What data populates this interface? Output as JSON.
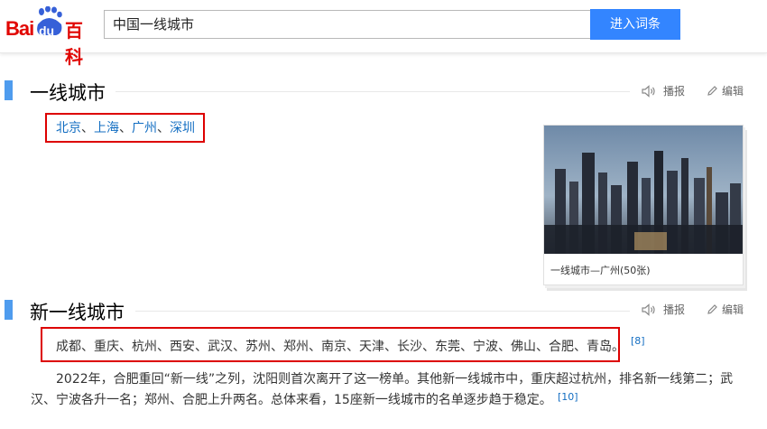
{
  "header": {
    "logo": {
      "bai": "Bai",
      "du": "du",
      "baike": "百科"
    },
    "search_value": "中国一线城市",
    "search_button": "进入词条"
  },
  "sections": [
    {
      "title": "一线城市",
      "tools": {
        "broadcast": "播报",
        "edit": "编辑"
      },
      "cities": [
        "北京",
        "上海",
        "广州",
        "深圳"
      ]
    },
    {
      "title": "新一线城市",
      "tools": {
        "broadcast": "播报",
        "edit": "编辑"
      },
      "cities": [
        "成都",
        "重庆",
        "杭州",
        "西安",
        "武汉",
        "苏州",
        "郑州",
        "南京",
        "天津",
        "长沙",
        "东莞",
        "宁波",
        "佛山",
        "合肥",
        "青岛"
      ],
      "cities_ref": "[8]",
      "paragraph_line1": "2022年，合肥重回“新一线”之列，沈阳则首次离开了这一榜单。其他新一线城市中，重庆超过杭州，排名新一线第二；武",
      "paragraph_line2": "汉、宁波各升一名；郑州、合肥上升两名。总体来看，15座新一线城市的名单逐步趋于稳定。",
      "paragraph_ref": "[10]"
    }
  ],
  "photo": {
    "caption": "一线城市—广州(50张)"
  },
  "colors": {
    "accent": "#4f9cee",
    "button": "#3385ff",
    "link": "#136ec2",
    "highlight_box": "#dd0000",
    "brand": "#e10602"
  }
}
